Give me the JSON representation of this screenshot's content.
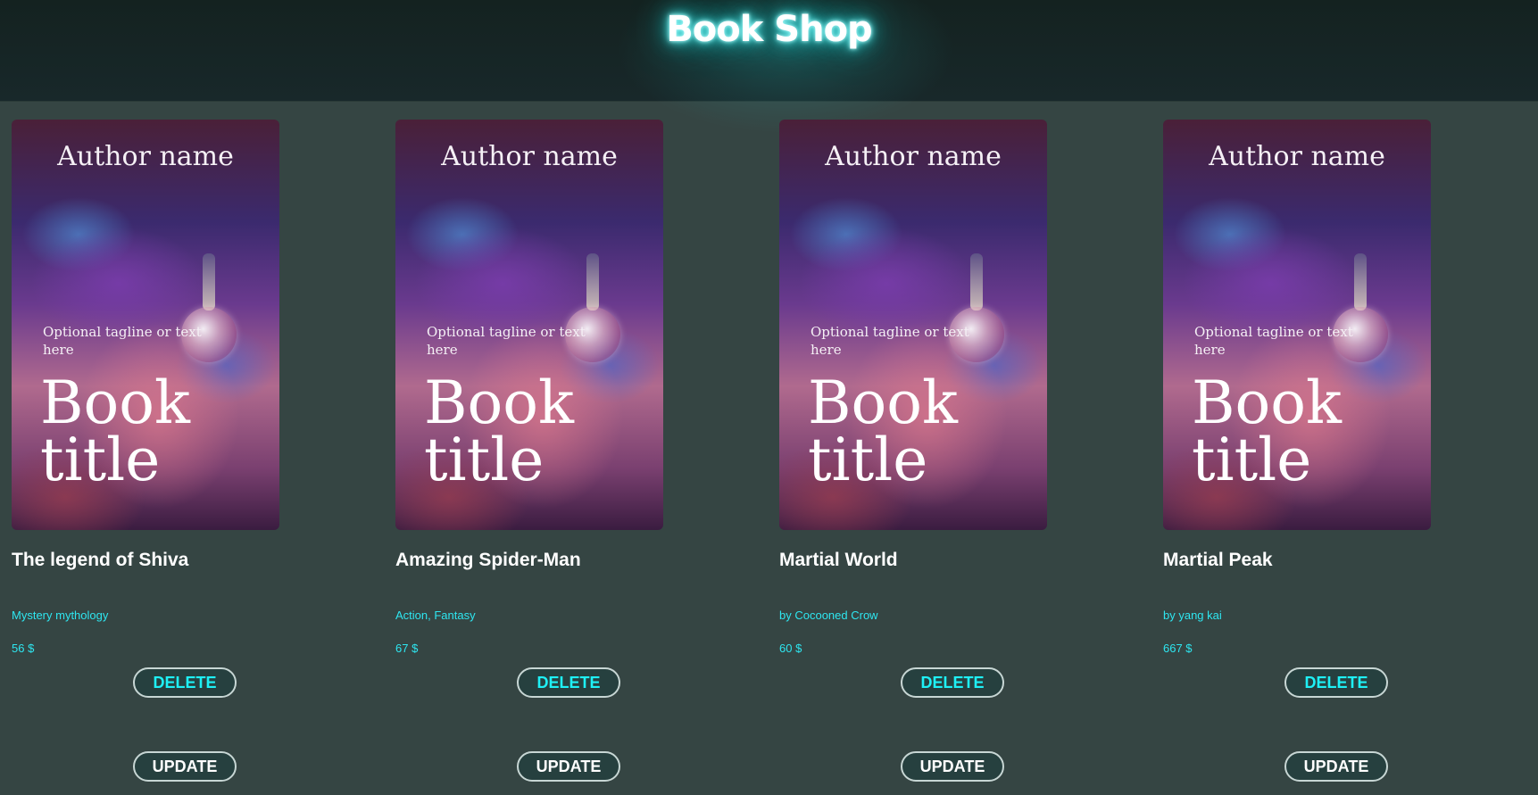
{
  "header": {
    "title": "Book Shop"
  },
  "books": [
    {
      "cover": {
        "author": "Author name",
        "tagline": "Optional tagline or text here",
        "title": "Book title"
      },
      "name": "The legend of Shiva",
      "genre": "Mystery mythology",
      "price": "56 $",
      "delete_label": "DELETE",
      "update_label": "UPDATE"
    },
    {
      "cover": {
        "author": "Author name",
        "tagline": "Optional tagline or text here",
        "title": "Book title"
      },
      "name": "Amazing Spider-Man",
      "genre": "Action, Fantasy",
      "price": "67 $",
      "delete_label": "DELETE",
      "update_label": "UPDATE"
    },
    {
      "cover": {
        "author": "Author name",
        "tagline": "Optional tagline or text here",
        "title": "Book title"
      },
      "name": "Martial World",
      "genre": "by Cocooned Crow",
      "price": "60 $",
      "delete_label": "DELETE",
      "update_label": "UPDATE"
    },
    {
      "cover": {
        "author": "Author name",
        "tagline": "Optional tagline or text here",
        "title": "Book title"
      },
      "name": "Martial Peak",
      "genre": "by yang kai",
      "price": "667 $",
      "delete_label": "DELETE",
      "update_label": "UPDATE"
    }
  ],
  "colors": {
    "background": "#354543",
    "header": "#142220",
    "accent": "#2ee6f0",
    "title_glow": "#22cccc"
  }
}
